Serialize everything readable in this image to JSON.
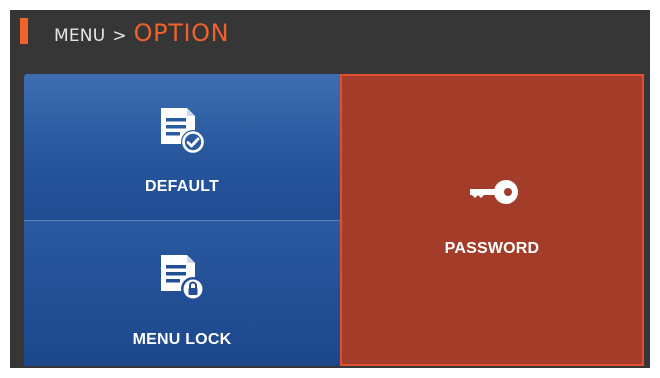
{
  "header": {
    "breadcrumb_root": "MENU",
    "separator": ">",
    "current": "OPTION",
    "accent_color": "#f0612b"
  },
  "tiles": [
    {
      "id": "default",
      "label": "DEFAULT",
      "icon": "document-check-icon",
      "selected": false
    },
    {
      "id": "menu_lock",
      "label": "MENU LOCK",
      "icon": "document-lock-icon",
      "selected": false
    },
    {
      "id": "password",
      "label": "PASSWORD",
      "icon": "key-icon",
      "selected": true
    }
  ],
  "colors": {
    "background": "#363636",
    "tile_blue": "#2a5aa0",
    "tile_selected": "#a33d2a",
    "tile_selected_border": "#e2502f"
  }
}
